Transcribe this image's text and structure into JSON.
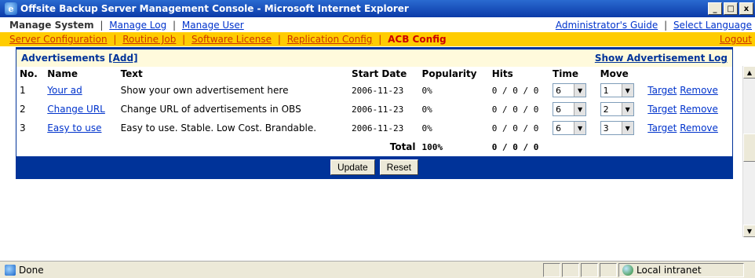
{
  "window": {
    "title": "Offsite Backup Server Management Console - Microsoft Internet Explorer",
    "icon": "ie-icon",
    "controls": [
      "_",
      "□",
      "x"
    ]
  },
  "nav_primary": {
    "current": "Manage System",
    "items": [
      "Manage Log",
      "Manage User"
    ],
    "right_items": [
      "Administrator's Guide",
      "Select Language"
    ]
  },
  "nav_secondary": {
    "items": [
      "Server Configuration",
      "Routine Job",
      "Software License",
      "Replication Config"
    ],
    "active": "ACB Config",
    "logout": "Logout"
  },
  "panel": {
    "title": "Advertisements",
    "add_label": "[Add]",
    "log_link": "Show Advertisement Log",
    "columns": [
      "No.",
      "Name",
      "Text",
      "Start Date",
      "Popularity",
      "Hits",
      "Time",
      "Move"
    ],
    "rows": [
      {
        "no": "1",
        "name": "Your ad",
        "text": "Show your own advertisement here",
        "start": "2006-11-23",
        "popularity": "0%",
        "hits": "0 / 0 / 0",
        "time": "6",
        "move": "1",
        "target": "Target",
        "remove": "Remove"
      },
      {
        "no": "2",
        "name": "Change URL",
        "text": "Change URL of advertisements in OBS",
        "start": "2006-11-23",
        "popularity": "0%",
        "hits": "0 / 0 / 0",
        "time": "6",
        "move": "2",
        "target": "Target",
        "remove": "Remove"
      },
      {
        "no": "3",
        "name": "Easy to use",
        "text": "Easy to use. Stable. Low Cost. Brandable.",
        "start": "2006-11-23",
        "popularity": "0%",
        "hits": "0 / 0 / 0",
        "time": "6",
        "move": "3",
        "target": "Target",
        "remove": "Remove"
      }
    ],
    "total_label": "Total",
    "total_popularity": "100%",
    "total_hits": "0 / 0 / 0",
    "update_button": "Update",
    "reset_button": "Reset"
  },
  "status": {
    "text": "Done",
    "zone": "Local intranet"
  }
}
